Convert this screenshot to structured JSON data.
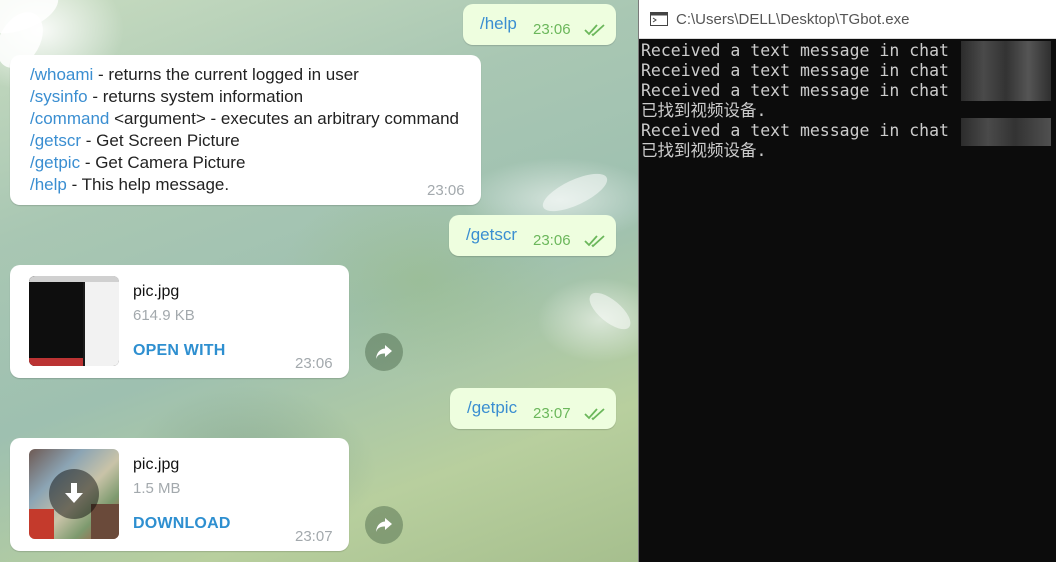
{
  "chat": {
    "msg_help": {
      "text": "/help",
      "time": "23:06"
    },
    "help_reply": {
      "lines": [
        {
          "cmd": "/whoami",
          "desc": " - returns the current logged in user"
        },
        {
          "cmd": "/sysinfo",
          "desc": " - returns system information"
        },
        {
          "cmd": "/command",
          "desc": " <argument> - executes an arbitrary command"
        },
        {
          "cmd": "/getscr",
          "desc": " - Get Screen Picture"
        },
        {
          "cmd": "/getpic",
          "desc": " - Get Camera Picture"
        },
        {
          "cmd": "/help",
          "desc": " - This help message."
        }
      ],
      "time": "23:06"
    },
    "msg_getscr": {
      "text": "/getscr",
      "time": "23:06"
    },
    "file1": {
      "name": "pic.jpg",
      "size": "614.9 KB",
      "action": "OPEN WITH",
      "time": "23:06",
      "icon": "share-icon"
    },
    "msg_getpic": {
      "text": "/getpic",
      "time": "23:07"
    },
    "file2": {
      "name": "pic.jpg",
      "size": "1.5 MB",
      "action": "DOWNLOAD",
      "time": "23:07",
      "icon": "download-icon"
    },
    "colors": {
      "outgoing": "#eefedf",
      "incoming": "#ffffff",
      "link": "#3a8ed1",
      "check": "#6bb75b"
    }
  },
  "console": {
    "title": "C:\\Users\\DELL\\Desktop\\TGbot.exe",
    "lines": [
      "Received a text message in chat",
      "Received a text message in chat",
      "Received a text message in chat",
      "已找到视频设备.",
      "Received a text message in chat",
      "已找到视频设备."
    ]
  }
}
